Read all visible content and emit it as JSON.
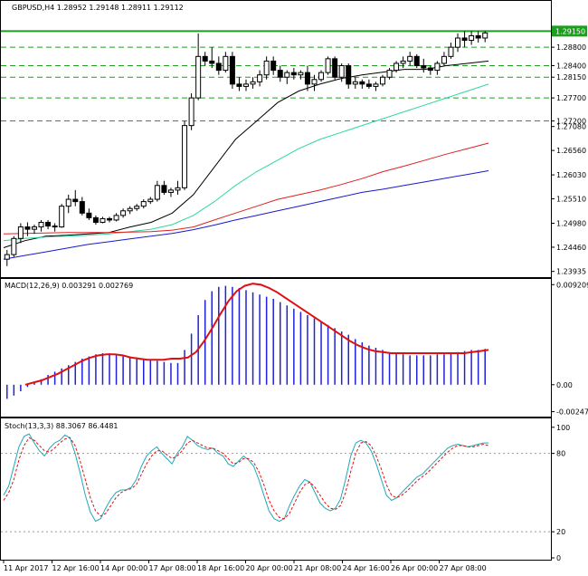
{
  "chart_data": {
    "type": "candlestick",
    "panels": [
      {
        "id": "price",
        "title": "GBPUSD,H4  1.28952 1.29148 1.28911 1.29112",
        "ylim": [
          1.2385,
          1.2955
        ],
        "y_ticks": [
          "1.29150",
          "1.28800",
          "1.28400",
          "1.28150",
          "1.27700",
          "1.27200",
          "1.27080",
          "1.26560",
          "1.26030",
          "1.25510",
          "1.24980",
          "1.24460",
          "1.23935"
        ],
        "y_tick_values": [
          1.2915,
          1.288,
          1.284,
          1.2815,
          1.277,
          1.272,
          1.2708,
          1.2656,
          1.2603,
          1.2551,
          1.2498,
          1.2446,
          1.23935
        ],
        "levels": [
          1.2915,
          1.288,
          1.284,
          1.2815,
          1.277,
          1.272
        ],
        "candles": [
          [
            1.242,
            1.244,
            1.2405,
            1.243
          ],
          [
            1.243,
            1.247,
            1.2425,
            1.2465
          ],
          [
            1.2465,
            1.2498,
            1.2455,
            1.249
          ],
          [
            1.249,
            1.25,
            1.247,
            1.2485
          ],
          [
            1.2485,
            1.2495,
            1.2475,
            1.249
          ],
          [
            1.249,
            1.2505,
            1.248,
            1.25
          ],
          [
            1.25,
            1.2505,
            1.2485,
            1.2492
          ],
          [
            1.2492,
            1.2498,
            1.248,
            1.249
          ],
          [
            1.249,
            1.254,
            1.2488,
            1.2535
          ],
          [
            1.2535,
            1.256,
            1.252,
            1.255
          ],
          [
            1.255,
            1.257,
            1.2535,
            1.2545
          ],
          [
            1.2545,
            1.2555,
            1.2515,
            1.252
          ],
          [
            1.252,
            1.253,
            1.2505,
            1.251
          ],
          [
            1.251,
            1.2515,
            1.2495,
            1.25
          ],
          [
            1.25,
            1.2512,
            1.2498,
            1.2508
          ],
          [
            1.2508,
            1.2512,
            1.25,
            1.2505
          ],
          [
            1.2505,
            1.252,
            1.2502,
            1.2515
          ],
          [
            1.2515,
            1.253,
            1.251,
            1.2525
          ],
          [
            1.2525,
            1.2535,
            1.2518,
            1.253
          ],
          [
            1.253,
            1.254,
            1.2525,
            1.2535
          ],
          [
            1.2535,
            1.255,
            1.253,
            1.2545
          ],
          [
            1.2545,
            1.2555,
            1.254,
            1.255
          ],
          [
            1.255,
            1.259,
            1.2545,
            1.258
          ],
          [
            1.258,
            1.259,
            1.256,
            1.2565
          ],
          [
            1.2565,
            1.2575,
            1.2555,
            1.257
          ],
          [
            1.257,
            1.259,
            1.256,
            1.2575
          ],
          [
            1.2575,
            1.272,
            1.257,
            1.271
          ],
          [
            1.271,
            1.278,
            1.27,
            1.277
          ],
          [
            1.277,
            1.291,
            1.2765,
            1.286
          ],
          [
            1.286,
            1.287,
            1.284,
            1.285
          ],
          [
            1.285,
            1.288,
            1.2835,
            1.2845
          ],
          [
            1.2845,
            1.286,
            1.282,
            1.283
          ],
          [
            1.283,
            1.287,
            1.2825,
            1.286
          ],
          [
            1.286,
            1.287,
            1.279,
            1.28
          ],
          [
            1.28,
            1.2815,
            1.2785,
            1.2795
          ],
          [
            1.2795,
            1.281,
            1.2785,
            1.28
          ],
          [
            1.28,
            1.2815,
            1.279,
            1.2805
          ],
          [
            1.2805,
            1.283,
            1.2795,
            1.282
          ],
          [
            1.282,
            1.286,
            1.281,
            1.285
          ],
          [
            1.285,
            1.286,
            1.282,
            1.283
          ],
          [
            1.283,
            1.284,
            1.2805,
            1.2815
          ],
          [
            1.2815,
            1.283,
            1.28,
            1.2825
          ],
          [
            1.2825,
            1.2835,
            1.281,
            1.282
          ],
          [
            1.282,
            1.283,
            1.281,
            1.2825
          ],
          [
            1.2825,
            1.284,
            1.2785,
            1.28
          ],
          [
            1.28,
            1.282,
            1.2785,
            1.281
          ],
          [
            1.281,
            1.283,
            1.2805,
            1.2825
          ],
          [
            1.2825,
            1.286,
            1.282,
            1.2855
          ],
          [
            1.2855,
            1.286,
            1.281,
            1.2815
          ],
          [
            1.2815,
            1.2845,
            1.2805,
            1.284
          ],
          [
            1.284,
            1.2845,
            1.279,
            1.28
          ],
          [
            1.28,
            1.2815,
            1.279,
            1.2805
          ],
          [
            1.2805,
            1.281,
            1.279,
            1.28
          ],
          [
            1.28,
            1.281,
            1.279,
            1.2795
          ],
          [
            1.2795,
            1.2805,
            1.2785,
            1.28
          ],
          [
            1.28,
            1.282,
            1.2795,
            1.2815
          ],
          [
            1.2815,
            1.2835,
            1.281,
            1.283
          ],
          [
            1.283,
            1.285,
            1.2825,
            1.2845
          ],
          [
            1.2845,
            1.286,
            1.2835,
            1.285
          ],
          [
            1.285,
            1.287,
            1.284,
            1.286
          ],
          [
            1.286,
            1.2865,
            1.2835,
            1.284
          ],
          [
            1.284,
            1.2855,
            1.2825,
            1.2835
          ],
          [
            1.2835,
            1.284,
            1.282,
            1.283
          ],
          [
            1.283,
            1.285,
            1.282,
            1.2845
          ],
          [
            1.2845,
            1.287,
            1.284,
            1.286
          ],
          [
            1.286,
            1.289,
            1.2855,
            1.288
          ],
          [
            1.288,
            1.291,
            1.287,
            1.29
          ],
          [
            1.29,
            1.2915,
            1.288,
            1.2895
          ],
          [
            1.2895,
            1.2915,
            1.2885,
            1.2905
          ],
          [
            1.2905,
            1.2915,
            1.289,
            1.29
          ],
          [
            1.29,
            1.2915,
            1.2891,
            1.2911
          ]
        ],
        "moving_averages": [
          {
            "color": "#000000",
            "points": [
              1.2445,
              1.246,
              1.247,
              1.2472,
              1.2475,
              1.2478,
              1.249,
              1.25,
              1.252,
              1.256,
              1.262,
              1.268,
              1.272,
              1.276,
              1.2785,
              1.28,
              1.2812,
              1.282,
              1.2826,
              1.2832,
              1.2832,
              1.284,
              1.2845,
              1.285
            ]
          },
          {
            "color": "#2fd6a0",
            "points": [
              1.246,
              1.2465,
              1.2468,
              1.247,
              1.2472,
              1.2475,
              1.248,
              1.2485,
              1.2495,
              1.2515,
              1.2545,
              1.258,
              1.261,
              1.2635,
              1.266,
              1.268,
              1.2695,
              1.271,
              1.2725,
              1.274,
              1.2755,
              1.277,
              1.2785,
              1.28
            ]
          },
          {
            "color": "#e02020",
            "points": [
              1.2475,
              1.2476,
              1.2477,
              1.2478,
              1.2478,
              1.2478,
              1.2479,
              1.248,
              1.2483,
              1.249,
              1.2505,
              1.252,
              1.2535,
              1.255,
              1.256,
              1.257,
              1.2582,
              1.2595,
              1.261,
              1.2622,
              1.2635,
              1.2648,
              1.266,
              1.2672
            ]
          },
          {
            "color": "#1a1acc",
            "points": [
              1.242,
              1.2428,
              1.2436,
              1.2444,
              1.2452,
              1.2458,
              1.2464,
              1.247,
              1.2476,
              1.2484,
              1.2494,
              1.2505,
              1.2515,
              1.2525,
              1.2535,
              1.2545,
              1.2555,
              1.2565,
              1.2572,
              1.258,
              1.2588,
              1.2596,
              1.2604,
              1.2612
            ]
          }
        ]
      },
      {
        "id": "macd",
        "title": "MACD(12,26,9) 0.003291 0.002769",
        "ylim": [
          -0.0026,
          0.0094
        ],
        "y_ticks": [
          "0.009209",
          "0.00",
          "-0.002479"
        ],
        "y_tick_values": [
          0.009209,
          0.0,
          -0.002479
        ],
        "histogram": [
          -0.0013,
          -0.001,
          -0.0006,
          -0.0002,
          0.0002,
          0.0005,
          0.0009,
          0.0012,
          0.0015,
          0.0018,
          0.0021,
          0.0024,
          0.0026,
          0.0028,
          0.0029,
          0.0029,
          0.0028,
          0.0027,
          0.0026,
          0.0025,
          0.0024,
          0.0023,
          0.0022,
          0.0021,
          0.002,
          0.002,
          0.0032,
          0.0047,
          0.0064,
          0.0078,
          0.0086,
          0.009,
          0.0091,
          0.009,
          0.0089,
          0.0087,
          0.0085,
          0.0083,
          0.0081,
          0.0079,
          0.0076,
          0.0073,
          0.007,
          0.0067,
          0.0064,
          0.0061,
          0.0058,
          0.0055,
          0.0052,
          0.0049,
          0.0046,
          0.0042,
          0.0039,
          0.0036,
          0.0034,
          0.0032,
          0.003,
          0.0029,
          0.0028,
          0.0027,
          0.0027,
          0.0027,
          0.0027,
          0.0028,
          0.0028,
          0.0029,
          0.003,
          0.0031,
          0.0032,
          0.0032,
          0.0033
        ],
        "signal": [
          0.0,
          0.0002,
          0.0004,
          0.0007,
          0.001,
          0.0014,
          0.0018,
          0.0022,
          0.0025,
          0.0027,
          0.0028,
          0.0028,
          0.0027,
          0.0025,
          0.0024,
          0.0023,
          0.0023,
          0.0023,
          0.0024,
          0.0024,
          0.0025,
          0.003,
          0.004,
          0.0052,
          0.0065,
          0.0077,
          0.0086,
          0.0091,
          0.0093,
          0.0092,
          0.0089,
          0.0085,
          0.008,
          0.0075,
          0.007,
          0.0065,
          0.006,
          0.0055,
          0.005,
          0.0045,
          0.004,
          0.0036,
          0.0033,
          0.0031,
          0.003,
          0.0029,
          0.0029,
          0.0029,
          0.0029,
          0.0029,
          0.0029,
          0.0029,
          0.0029,
          0.0029,
          0.0029,
          0.003,
          0.0031,
          0.0032
        ]
      },
      {
        "id": "stoch",
        "title": "Stoch(13,3,3) 88.3067 86.4481",
        "ylim": [
          0,
          104
        ],
        "y_ticks": [
          "100",
          "80",
          "20",
          "0"
        ],
        "y_tick_values": [
          100,
          80,
          20,
          0
        ],
        "main": [
          48,
          55,
          70,
          85,
          93,
          95,
          88,
          82,
          78,
          84,
          88,
          90,
          94,
          92,
          80,
          65,
          48,
          35,
          28,
          30,
          38,
          45,
          50,
          52,
          52,
          54,
          60,
          70,
          78,
          82,
          85,
          80,
          76,
          72,
          80,
          85,
          93,
          90,
          86,
          84,
          83,
          84,
          80,
          78,
          72,
          70,
          74,
          78,
          75,
          70,
          60,
          48,
          36,
          30,
          28,
          30,
          40,
          48,
          55,
          60,
          58,
          50,
          42,
          38,
          36,
          38,
          45,
          60,
          78,
          88,
          90,
          88,
          82,
          72,
          60,
          48,
          44,
          46,
          50,
          54,
          58,
          62,
          64,
          68,
          72,
          76,
          80,
          84,
          86,
          87,
          86,
          85,
          86,
          87,
          88,
          88
        ],
        "signal": [
          44,
          50,
          60,
          75,
          86,
          92,
          90,
          86,
          82,
          81,
          84,
          88,
          91,
          92,
          86,
          74,
          60,
          46,
          36,
          32,
          34,
          40,
          46,
          50,
          52,
          53,
          56,
          64,
          72,
          78,
          82,
          82,
          79,
          76,
          78,
          82,
          88,
          90,
          88,
          86,
          84,
          84,
          82,
          80,
          76,
          72,
          73,
          76,
          76,
          73,
          66,
          56,
          44,
          36,
          31,
          30,
          34,
          42,
          50,
          56,
          58,
          54,
          48,
          42,
          38,
          37,
          40,
          50,
          66,
          80,
          88,
          89,
          86,
          78,
          68,
          56,
          48,
          46,
          48,
          51,
          55,
          59,
          62,
          65,
          69,
          73,
          77,
          81,
          84,
          86,
          86,
          85,
          85,
          86,
          87,
          86
        ]
      }
    ],
    "x_ticks": [
      "11 Apr 2017",
      "12 Apr 16:00",
      "14 Apr 00:00",
      "17 Apr 08:00",
      "18 Apr 16:00",
      "20 Apr 00:00",
      "21 Apr 08:00",
      "24 Apr 16:00",
      "26 Apr 00:00",
      "27 Apr 08:00"
    ],
    "current_price_label": "1.29150"
  }
}
